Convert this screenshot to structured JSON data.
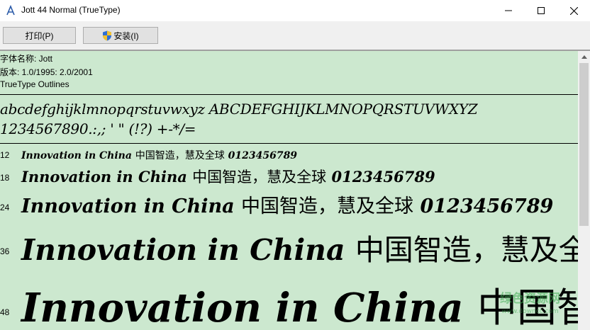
{
  "window": {
    "title": "Jott 44 Normal (TrueType)"
  },
  "toolbar": {
    "print_label": "打印(P)",
    "install_label": "安装(I)"
  },
  "font_info": {
    "name_line": "字体名称: Jott",
    "version_line": "版本: 1.0/1995: 2.0/2001",
    "type_line": "TrueType Outlines"
  },
  "charset": {
    "line1": "abcdefghijklmnopqrstuvwxyz ABCDEFGHIJKLMNOPQRSTUVWXYZ",
    "line2": "1234567890.:,; ' \" (!?) +-*/="
  },
  "samples": [
    {
      "size": "12",
      "latin": "Innovation in China",
      "cjk": "中国智造，慧及全球",
      "digits": "0123456789"
    },
    {
      "size": "18",
      "latin": "Innovation in China",
      "cjk": "中国智造，慧及全球",
      "digits": "0123456789"
    },
    {
      "size": "24",
      "latin": "Innovation in China",
      "cjk": "中国智造，慧及全球",
      "digits": "0123456789"
    },
    {
      "size": "36",
      "latin": "Innovation in China",
      "cjk": "中国智造，慧及全",
      "digits": ""
    },
    {
      "size": "48",
      "latin": "Innovation in China",
      "cjk": "中国智",
      "digits": ""
    }
  ],
  "watermark": {
    "main": "绿色资源网",
    "sub": "www.downcc.com"
  },
  "icons": {
    "app": "font-viewer-icon",
    "install": "uac-shield-icon"
  },
  "colors": {
    "content_bg": "#cce8cf",
    "toolbar_bg": "#f0f0f0"
  }
}
